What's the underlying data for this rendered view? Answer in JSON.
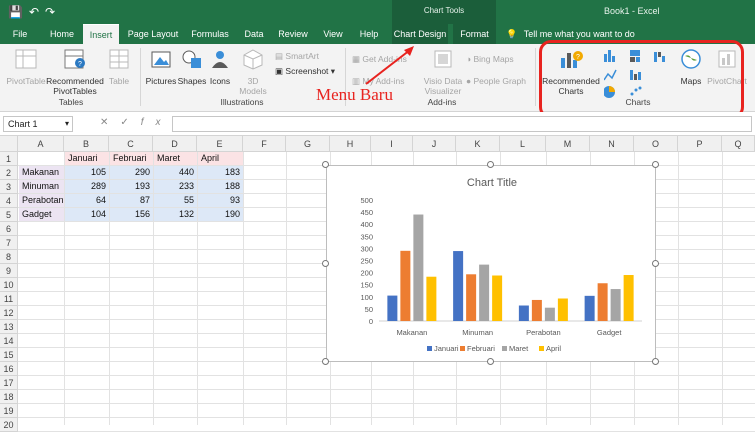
{
  "titlebar": {
    "context_group": "Chart Tools",
    "document_title": "Book1 - Excel"
  },
  "tabs": [
    {
      "label": "File"
    },
    {
      "label": "Home"
    },
    {
      "label": "Insert"
    },
    {
      "label": "Page Layout"
    },
    {
      "label": "Formulas"
    },
    {
      "label": "Data"
    },
    {
      "label": "Review"
    },
    {
      "label": "View"
    },
    {
      "label": "Help"
    },
    {
      "label": "Chart Design"
    },
    {
      "label": "Format"
    }
  ],
  "tell_me": "Tell me what you want to do",
  "ribbon": {
    "tables": {
      "pivottable": "PivotTable",
      "recommended_pivottables_1": "Recommended",
      "recommended_pivottables_2": "PivotTables",
      "table": "Table",
      "group": "Tables"
    },
    "illustrations": {
      "pictures": "Pictures",
      "shapes": "Shapes",
      "icons": "Icons",
      "models_1": "3D",
      "models_2": "Models",
      "smartart": "SmartArt",
      "screenshot": "Screenshot",
      "group": "Illustrations"
    },
    "addins": {
      "get_addins": "Get Add-ins",
      "my_addins": "My Add-ins",
      "visio_1": "Visio Data",
      "visio_2": "Visualizer",
      "bing_maps": "Bing Maps",
      "people_graph": "People Graph",
      "group": "Add-ins"
    },
    "charts": {
      "recommended_1": "Recommended",
      "recommended_2": "Charts",
      "maps": "Maps",
      "pivotchart": "PivotChart",
      "group": "Charts"
    }
  },
  "annotation": {
    "text": "Menu Baru",
    "color": "#e8231f"
  },
  "formula_bar": {
    "name_box": "Chart 1",
    "fx": "fx",
    "value": ""
  },
  "sheet": {
    "columns": [
      "A",
      "B",
      "C",
      "D",
      "E",
      "F",
      "G",
      "H",
      "I",
      "J",
      "K",
      "L",
      "M",
      "N",
      "O",
      "P",
      "Q"
    ],
    "rows": [
      "1",
      "2",
      "3",
      "4",
      "5",
      "6",
      "7",
      "8",
      "9",
      "10",
      "11",
      "12",
      "13",
      "14",
      "15",
      "16",
      "17",
      "18",
      "19",
      "20"
    ],
    "header_row": [
      "Januari",
      "Februari",
      "Maret",
      "April"
    ],
    "data_rows": [
      {
        "label": "Makanan",
        "values": [
          "105",
          "290",
          "440",
          "183"
        ]
      },
      {
        "label": "Minuman",
        "values": [
          "289",
          "193",
          "233",
          "188"
        ]
      },
      {
        "label": "Perabotan",
        "values": [
          "64",
          "87",
          "55",
          "93"
        ]
      },
      {
        "label": "Gadget",
        "values": [
          "104",
          "156",
          "132",
          "190"
        ]
      }
    ]
  },
  "chart_data": {
    "type": "bar",
    "title": "Chart Title",
    "categories": [
      "Makanan",
      "Minuman",
      "Perabotan",
      "Gadget"
    ],
    "series": [
      {
        "name": "Januari",
        "values": [
          105,
          289,
          64,
          104
        ],
        "color": "#4472c4"
      },
      {
        "name": "Februari",
        "values": [
          290,
          193,
          87,
          156
        ],
        "color": "#ed7d31"
      },
      {
        "name": "Maret",
        "values": [
          440,
          233,
          55,
          132
        ],
        "color": "#a5a5a5"
      },
      {
        "name": "April",
        "values": [
          183,
          188,
          93,
          190
        ],
        "color": "#ffc000"
      }
    ],
    "ylim": [
      0,
      500
    ],
    "yticks": [
      "0",
      "50",
      "100",
      "150",
      "200",
      "250",
      "300",
      "350",
      "400",
      "450",
      "500"
    ],
    "grid": false,
    "legend_position": "bottom"
  },
  "colors": {
    "excel_green": "#217346",
    "annotation_red": "#e8231f"
  }
}
